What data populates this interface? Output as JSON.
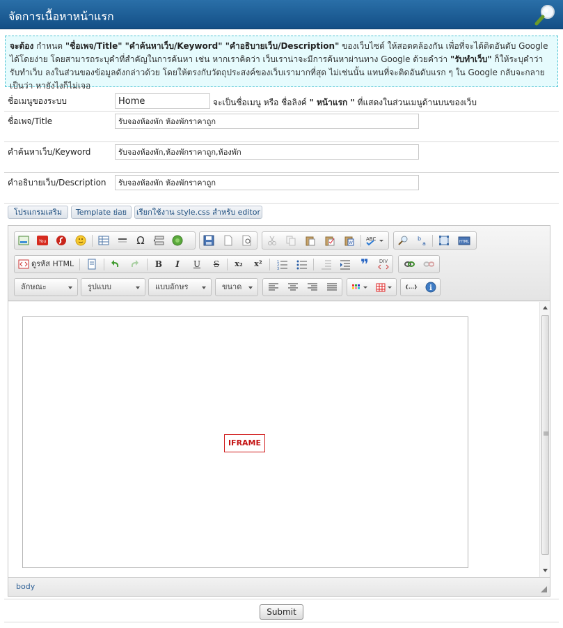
{
  "header": {
    "title": "จัดการเนื้อหาหน้าแรก"
  },
  "notice": {
    "lead": "จะต้อง",
    "part1": " กำหนด ",
    "b1": "\"ชื่อเพจ/Title\" \"คำค้นหาเว็บ/Keyword\" \"คำอธิบายเว็บ/Description\"",
    "part2": " ของเว็บไซต์ ให้สอดคล้องกัน เพื่อที่จะได้ติดอันดับ Google ได้โดยง่าย โดยสามารถระบุคำที่สำคัญในการค้นหา เช่น หากเราคิดว่า เว็บเราน่าจะมีการค้นหาผ่านทาง Google ด้วยคำว่า ",
    "b2": "\"รับทำเว็บ\"",
    "part3": " ก็ให้ระบุคำว่า รับทำเว็บ ลงในส่วนของข้อมูลดังกล่าวด้วย โดยให้ตรงกับวัตถุประสงค์ของเว็บเรามากที่สุด ไม่เช่นนั้น แทนที่จะติดอันดับแรก ๆ ใน Google กลับจะกลายเป็นว่า หายังไงก็ไม่เจอ"
  },
  "form": {
    "menu_label": "ชื่อเมนูของระบบ",
    "menu_value": "Home",
    "menu_hint_1": "จะเป็นชื่อเมนู หรือ ชื่อลิงค์ ",
    "menu_hint_bold": "\" หน้าแรก \"",
    "menu_hint_2": " ที่แสดงในส่วนเมนูด้านบนของเว็บ",
    "title_label": "ชื่อเพจ/Title",
    "title_value": "รับจองห้องพัก ห้องพักราคาถูก",
    "keyword_label": "คำค้นหาเว็บ/Keyword",
    "keyword_value": "รับจองห้องพัก,ห้องพักราคาถูก,ห้องพัก",
    "description_label": "คำอธิบายเว็บ/Description",
    "description_value": "รับจองห้องพัก ห้องพักราคาถูก"
  },
  "tabs": [
    {
      "label": "โปรแกรมเสริม"
    },
    {
      "label": "Template ย่อย"
    },
    {
      "label": "เรียกใช้งาน style.css สำหรับ editor"
    }
  ],
  "editor": {
    "source_label": "ดูรหัส HTML",
    "format_combo": "ลักษณะ",
    "style_combo": "รูปแบบ",
    "font_combo": "แบบอักษร",
    "size_combo": "ขนาด",
    "iframe_placeholder": "IFRAME",
    "status_path": "body",
    "icons": {
      "bold": "B",
      "italic": "I",
      "underline": "U",
      "strike": "S",
      "subscript": "x₂",
      "superscript": "x²",
      "omega": "Ω",
      "quote": "❞",
      "div": "DIV",
      "code": "{...}",
      "info": "i"
    }
  },
  "submit_label": "Submit",
  "colors": {
    "header_bg": "#1b5c95",
    "notice_bg": "#e6fbfd",
    "notice_border": "#4fc3d3",
    "link": "#1c4d7e",
    "iframe_red": "#c41414"
  }
}
